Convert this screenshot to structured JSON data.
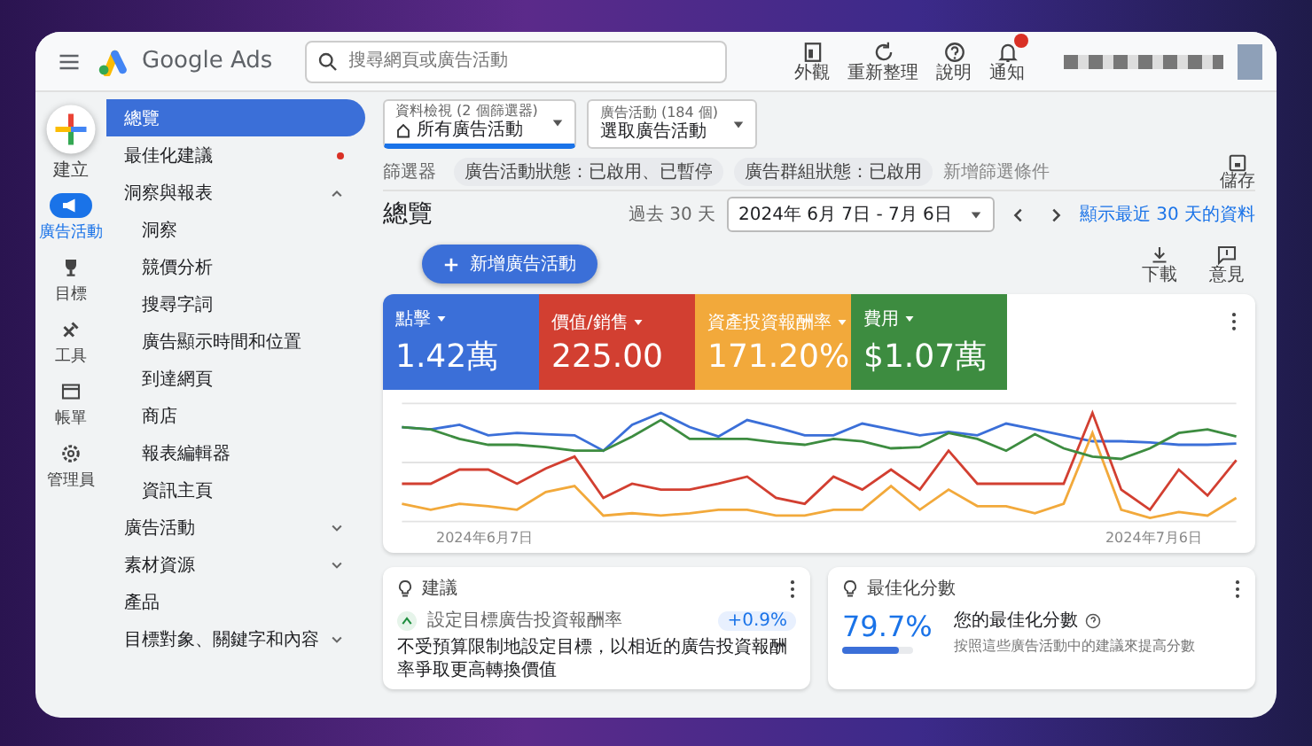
{
  "header": {
    "product": "Google Ads",
    "search": {
      "placeholder": "搜尋網頁或廣告活動"
    },
    "actions": [
      {
        "label": "外觀",
        "kind": "appearance"
      },
      {
        "label": "重新整理",
        "kind": "refresh"
      },
      {
        "label": "說明",
        "kind": "help"
      },
      {
        "label": "通知",
        "kind": "notifications",
        "badge": true
      }
    ]
  },
  "create_button": {
    "label": "建立"
  },
  "rail": [
    {
      "label": "廣告活動",
      "kind": "campaigns",
      "selected": true
    },
    {
      "label": "目標",
      "kind": "goals",
      "selected": false
    },
    {
      "label": "工具",
      "kind": "tools",
      "selected": false
    },
    {
      "label": "帳單",
      "kind": "billing",
      "selected": false
    },
    {
      "label": "管理員",
      "kind": "admin",
      "selected": false
    }
  ],
  "nav": [
    {
      "label": "總覽",
      "kind": "page",
      "selected": true,
      "dot": false
    },
    {
      "label": "最佳化建議",
      "kind": "page",
      "selected": false,
      "dot": true
    },
    {
      "label": "洞察與報表",
      "kind": "section",
      "selected": false,
      "expanded": true,
      "children": [
        {
          "label": "洞察",
          "selected": false
        },
        {
          "label": "競價分析",
          "selected": false
        },
        {
          "label": "搜尋字詞",
          "selected": false
        },
        {
          "label": "廣告顯示時間和位置",
          "selected": false
        },
        {
          "label": "到達網頁",
          "selected": false
        },
        {
          "label": "商店",
          "selected": false
        },
        {
          "label": "報表編輯器",
          "selected": false
        },
        {
          "label": "資訊主頁",
          "selected": false
        }
      ]
    },
    {
      "label": "廣告活動",
      "kind": "section",
      "selected": false,
      "expanded": false
    },
    {
      "label": "素材資源",
      "kind": "section",
      "selected": false,
      "expanded": false
    },
    {
      "label": "產品",
      "kind": "page",
      "selected": false,
      "dot": false
    },
    {
      "label": "目標對象、關鍵字和內容",
      "kind": "section",
      "selected": false,
      "expanded": false
    }
  ],
  "pickers": [
    {
      "caption": "資料檢視 (2 個篩選器)",
      "value": "所有廣告活動",
      "kind": "view",
      "selected": true
    },
    {
      "caption": "廣告活動 (184 個)",
      "value": "選取廣告活動",
      "kind": "campaigns",
      "selected": false
    }
  ],
  "filters": {
    "label": "篩選器",
    "chips": [
      "廣告活動狀態：已啟用、已暫停",
      "廣告群組狀態：已啟用"
    ],
    "add": "新增篩選條件",
    "save": "儲存"
  },
  "page_title": "總覽",
  "date_range": {
    "preset": "過去 30 天",
    "value": "2024年 6月 7日 - 7月 6日",
    "link": "顯示最近 30 天的資料"
  },
  "new_campaign_button": "新增廣告活動",
  "tools": [
    {
      "label": "下載",
      "kind": "download"
    },
    {
      "label": "意見",
      "kind": "feedback"
    }
  ],
  "performance": {
    "metrics": [
      {
        "label": "點擊",
        "value": "1.42萬",
        "color": "#3b6fd8"
      },
      {
        "label": "價值/銷售",
        "value": "225.00",
        "color": "#d23f31"
      },
      {
        "label": "資產投資報酬率",
        "value": "171.20%",
        "color": "#f2a93b"
      },
      {
        "label": "費用",
        "value": "$1.07萬",
        "color": "#3d8c40"
      }
    ],
    "x_start": "2024年6月7日",
    "x_end": "2024年7月6日"
  },
  "recommendations": {
    "title": "建議",
    "item": {
      "title": "設定目標廣告投資報酬率",
      "badge": "+0.9%",
      "text": "不受預算限制地設定目標，以相近的廣告投資報酬率爭取更高轉換價值"
    }
  },
  "optimization": {
    "title": "最佳化分數",
    "score": "79.7%",
    "level": 0.797,
    "heading": "您的最佳化分數",
    "subtitle": "按照這些廣告活動中的建議來提高分數"
  }
}
